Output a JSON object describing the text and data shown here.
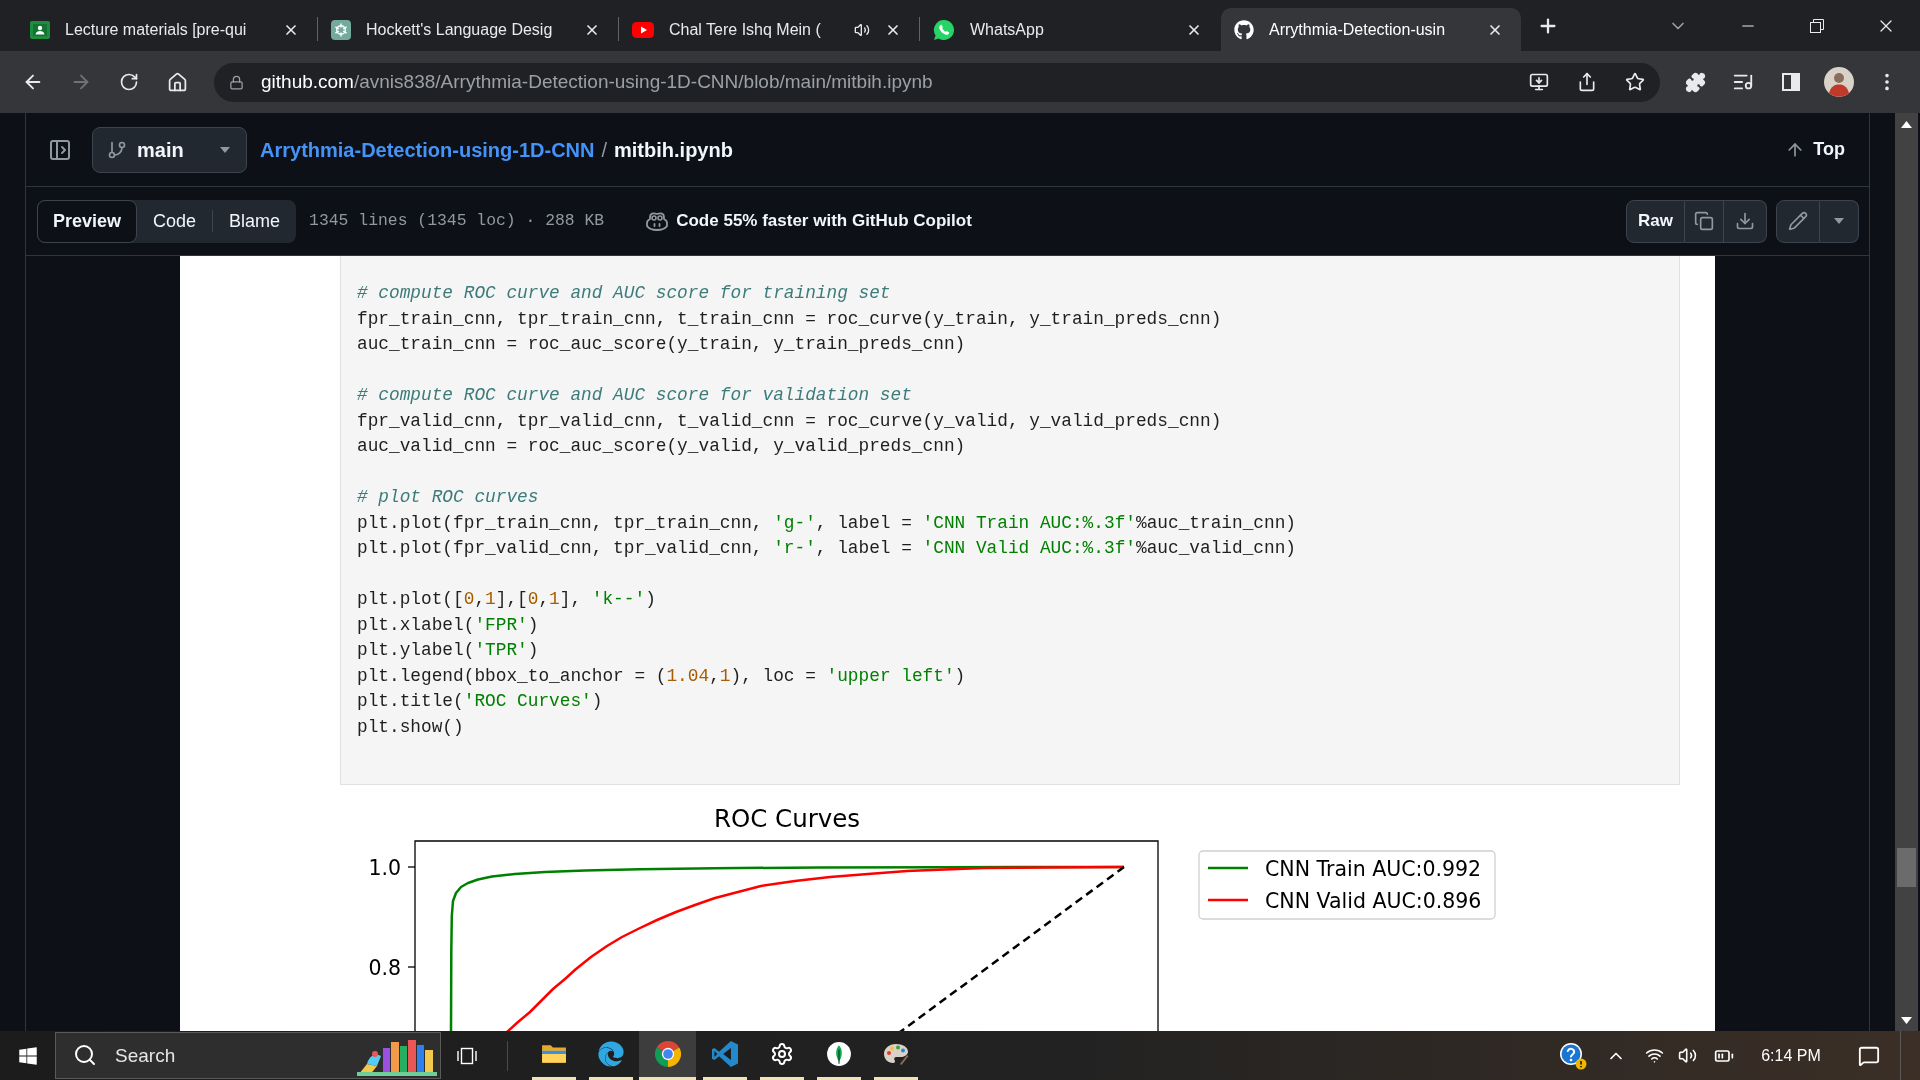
{
  "browser": {
    "tabs": [
      {
        "title": "Lecture materials [pre-qui",
        "selected": false,
        "playing_audio": false
      },
      {
        "title": "Hockett's Language Desig",
        "selected": false,
        "playing_audio": false
      },
      {
        "title": "Chal Tere Ishq Mein (",
        "selected": false,
        "playing_audio": true
      },
      {
        "title": "WhatsApp",
        "selected": false,
        "playing_audio": false
      },
      {
        "title": "Arrythmia-Detection-usin",
        "selected": true,
        "playing_audio": false
      }
    ],
    "forward_disabled": true,
    "address": {
      "host": "github.com",
      "path": "/avnis838/Arrythmia-Detection-using-1D-CNN/blob/main/mitbih.ipynb"
    }
  },
  "repo_header": {
    "branch": "main",
    "repo": "Arrythmia-Detection-using-1D-CNN",
    "separator": "/",
    "file": "mitbih.ipynb",
    "top": "Top"
  },
  "file_toolbar": {
    "views": [
      {
        "label": "Preview",
        "selected": true
      },
      {
        "label": "Code",
        "selected": false
      },
      {
        "label": "Blame",
        "selected": false
      }
    ],
    "stats": "1345 lines (1345 loc) · 288 KB",
    "copilot": "Code 55% faster with GitHub Copilot",
    "raw": "Raw"
  },
  "notebook": {
    "code_blocks": [
      [
        [
          {
            "kind": "comment",
            "text": "# compute ROC curve and AUC score for training set"
          }
        ],
        [
          {
            "kind": "text",
            "text": "fpr_train_cnn, tpr_train_cnn, t_train_cnn = roc_curve(y_train, y_train_preds_cnn)"
          }
        ],
        [
          {
            "kind": "text",
            "text": "auc_train_cnn = roc_auc_score(y_train, y_train_preds_cnn)"
          }
        ]
      ],
      [
        [
          {
            "kind": "comment",
            "text": "# compute ROC curve and AUC score for validation set"
          }
        ],
        [
          {
            "kind": "text",
            "text": "fpr_valid_cnn, tpr_valid_cnn, t_valid_cnn = roc_curve(y_valid, y_valid_preds_cnn)"
          }
        ],
        [
          {
            "kind": "text",
            "text": "auc_valid_cnn = roc_auc_score(y_valid, y_valid_preds_cnn)"
          }
        ]
      ],
      [
        [
          {
            "kind": "comment",
            "text": "# plot ROC curves"
          }
        ],
        [
          {
            "kind": "text",
            "text": "plt.plot(fpr_train_cnn, tpr_train_cnn, "
          },
          {
            "kind": "string",
            "text": "'g-'"
          },
          {
            "kind": "text",
            "text": ", label = "
          },
          {
            "kind": "string",
            "text": "'CNN Train AUC:%.3f'"
          },
          {
            "kind": "text",
            "text": "%auc_train_cnn)"
          }
        ],
        [
          {
            "kind": "text",
            "text": "plt.plot(fpr_valid_cnn, tpr_valid_cnn, "
          },
          {
            "kind": "string",
            "text": "'r-'"
          },
          {
            "kind": "text",
            "text": ", label = "
          },
          {
            "kind": "string",
            "text": "'CNN Valid AUC:%.3f'"
          },
          {
            "kind": "text",
            "text": "%auc_valid_cnn)"
          }
        ]
      ],
      [
        [
          {
            "kind": "text",
            "text": "plt.plot(["
          },
          {
            "kind": "number",
            "text": "0"
          },
          {
            "kind": "text",
            "text": ","
          },
          {
            "kind": "number",
            "text": "1"
          },
          {
            "kind": "text",
            "text": "],["
          },
          {
            "kind": "number",
            "text": "0"
          },
          {
            "kind": "text",
            "text": ","
          },
          {
            "kind": "number",
            "text": "1"
          },
          {
            "kind": "text",
            "text": "], "
          },
          {
            "kind": "string",
            "text": "'k--'"
          },
          {
            "kind": "text",
            "text": ")"
          }
        ],
        [
          {
            "kind": "text",
            "text": "plt.xlabel("
          },
          {
            "kind": "string",
            "text": "'FPR'"
          },
          {
            "kind": "text",
            "text": ")"
          }
        ],
        [
          {
            "kind": "text",
            "text": "plt.ylabel("
          },
          {
            "kind": "string",
            "text": "'TPR'"
          },
          {
            "kind": "text",
            "text": ")"
          }
        ],
        [
          {
            "kind": "text",
            "text": "plt.legend(bbox_to_anchor = ("
          },
          {
            "kind": "number",
            "text": "1.04"
          },
          {
            "kind": "text",
            "text": ","
          },
          {
            "kind": "number",
            "text": "1"
          },
          {
            "kind": "text",
            "text": "), loc = "
          },
          {
            "kind": "string",
            "text": "'upper left'"
          },
          {
            "kind": "text",
            "text": ")"
          }
        ],
        [
          {
            "kind": "text",
            "text": "plt.title("
          },
          {
            "kind": "string",
            "text": "'ROC Curves'"
          },
          {
            "kind": "text",
            "text": ")"
          }
        ],
        [
          {
            "kind": "text",
            "text": "plt.show()"
          }
        ]
      ]
    ],
    "chart": {
      "title": "ROC Curves",
      "yticks": [
        "1.0",
        "0.8"
      ],
      "legend": [
        {
          "label": "CNN Train AUC:0.992",
          "color": "#008000"
        },
        {
          "label": "CNN Valid AUC:0.896",
          "color": "#ff0000"
        }
      ]
    }
  },
  "taskbar": {
    "search": {
      "placeholder": "Search"
    },
    "apps": [
      {
        "running": true,
        "selected": false
      },
      {
        "running": true,
        "selected": false
      },
      {
        "running": true,
        "selected": true
      },
      {
        "running": true,
        "selected": false
      },
      {
        "running": true,
        "selected": false
      },
      {
        "running": true,
        "selected": false
      },
      {
        "running": true,
        "selected": false
      }
    ],
    "time": "6:14 PM"
  }
}
